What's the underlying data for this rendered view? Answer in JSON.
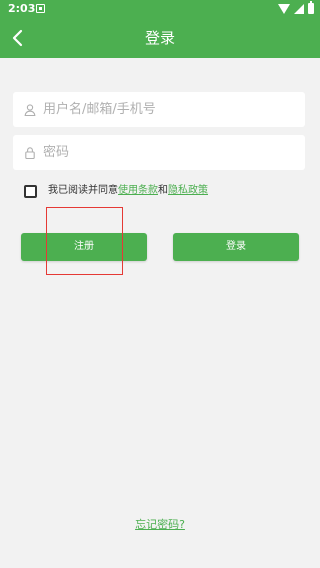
{
  "status_bar": {
    "time": "2:03",
    "icons": [
      "notification-icon",
      "wifi-icon",
      "signal-icon",
      "battery-icon"
    ]
  },
  "header": {
    "title": "登录",
    "back_icon": "chevron-left-icon"
  },
  "form": {
    "username_placeholder": "用户名/邮箱/手机号",
    "username_value": "",
    "username_icon": "user-icon",
    "password_placeholder": "密码",
    "password_value": "",
    "password_icon": "lock-icon"
  },
  "agreement": {
    "checked": false,
    "prefix": "我已阅读并同意",
    "terms_link": "使用条款",
    "conjunction": "和",
    "privacy_link": "隐私政策"
  },
  "buttons": {
    "register_label": "注册",
    "login_label": "登录"
  },
  "footer": {
    "forgot_password": "忘记密码?"
  },
  "colors": {
    "primary": "#4caf50",
    "background": "#f2f2f2",
    "highlight": "#e53935"
  }
}
